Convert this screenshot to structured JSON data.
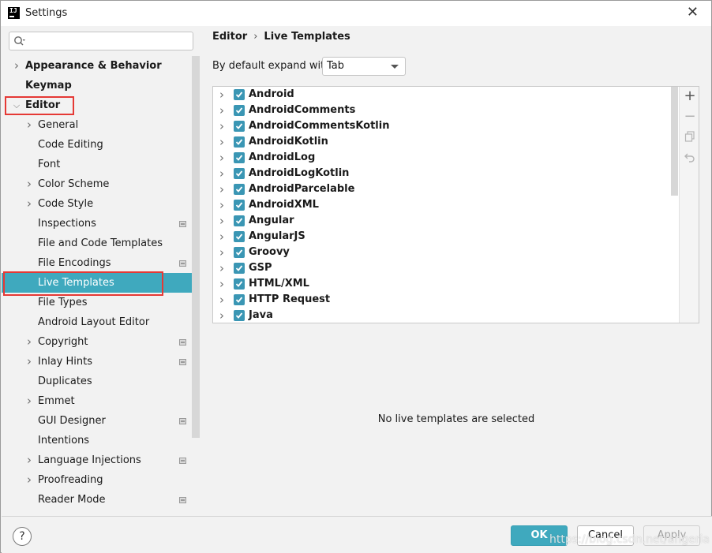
{
  "window": {
    "title": "Settings",
    "app_icon": "intellij-idea-icon",
    "close_icon": "close-icon"
  },
  "search": {
    "placeholder": "",
    "icon": "search-icon"
  },
  "tree": [
    {
      "label": "Appearance & Behavior",
      "level": 0,
      "bold": true,
      "chevron": "right",
      "project": false
    },
    {
      "label": "Keymap",
      "level": 0,
      "bold": true,
      "chevron": "none",
      "project": false
    },
    {
      "label": "Editor",
      "level": 0,
      "bold": true,
      "chevron": "down",
      "project": false,
      "highlighted": true
    },
    {
      "label": "General",
      "level": 1,
      "bold": false,
      "chevron": "right",
      "project": false
    },
    {
      "label": "Code Editing",
      "level": 1,
      "bold": false,
      "chevron": "none",
      "project": false
    },
    {
      "label": "Font",
      "level": 1,
      "bold": false,
      "chevron": "none",
      "project": false
    },
    {
      "label": "Color Scheme",
      "level": 1,
      "bold": false,
      "chevron": "right",
      "project": false
    },
    {
      "label": "Code Style",
      "level": 1,
      "bold": false,
      "chevron": "right",
      "project": false
    },
    {
      "label": "Inspections",
      "level": 1,
      "bold": false,
      "chevron": "none",
      "project": true
    },
    {
      "label": "File and Code Templates",
      "level": 1,
      "bold": false,
      "chevron": "none",
      "project": false
    },
    {
      "label": "File Encodings",
      "level": 1,
      "bold": false,
      "chevron": "none",
      "project": true
    },
    {
      "label": "Live Templates",
      "level": 1,
      "bold": false,
      "chevron": "none",
      "project": false,
      "selected": true,
      "highlighted": true
    },
    {
      "label": "File Types",
      "level": 1,
      "bold": false,
      "chevron": "none",
      "project": false
    },
    {
      "label": "Android Layout Editor",
      "level": 1,
      "bold": false,
      "chevron": "none",
      "project": false
    },
    {
      "label": "Copyright",
      "level": 1,
      "bold": false,
      "chevron": "right",
      "project": true
    },
    {
      "label": "Inlay Hints",
      "level": 1,
      "bold": false,
      "chevron": "right",
      "project": true
    },
    {
      "label": "Duplicates",
      "level": 1,
      "bold": false,
      "chevron": "none",
      "project": false
    },
    {
      "label": "Emmet",
      "level": 1,
      "bold": false,
      "chevron": "right",
      "project": false
    },
    {
      "label": "GUI Designer",
      "level": 1,
      "bold": false,
      "chevron": "none",
      "project": true
    },
    {
      "label": "Intentions",
      "level": 1,
      "bold": false,
      "chevron": "none",
      "project": false
    },
    {
      "label": "Language Injections",
      "level": 1,
      "bold": false,
      "chevron": "right",
      "project": true
    },
    {
      "label": "Proofreading",
      "level": 1,
      "bold": false,
      "chevron": "right",
      "project": false
    },
    {
      "label": "Reader Mode",
      "level": 1,
      "bold": false,
      "chevron": "none",
      "project": true
    }
  ],
  "breadcrumb": {
    "parent": "Editor",
    "current": "Live Templates",
    "separator": "›"
  },
  "expand": {
    "label": "By default expand with",
    "value": "Tab"
  },
  "template_groups": [
    {
      "label": "Android",
      "checked": true
    },
    {
      "label": "AndroidComments",
      "checked": true
    },
    {
      "label": "AndroidCommentsKotlin",
      "checked": true
    },
    {
      "label": "AndroidKotlin",
      "checked": true
    },
    {
      "label": "AndroidLog",
      "checked": true
    },
    {
      "label": "AndroidLogKotlin",
      "checked": true
    },
    {
      "label": "AndroidParcelable",
      "checked": true
    },
    {
      "label": "AndroidXML",
      "checked": true
    },
    {
      "label": "Angular",
      "checked": true
    },
    {
      "label": "AngularJS",
      "checked": true
    },
    {
      "label": "Groovy",
      "checked": true
    },
    {
      "label": "GSP",
      "checked": true
    },
    {
      "label": "HTML/XML",
      "checked": true
    },
    {
      "label": "HTTP Request",
      "checked": true
    },
    {
      "label": "Java",
      "checked": true
    }
  ],
  "toolbar": {
    "add": "+",
    "remove": "−",
    "copy_icon": "copy-icon",
    "restore_icon": "undo-icon"
  },
  "details": {
    "empty_message": "No live templates are selected"
  },
  "footer": {
    "help": "?",
    "ok": "OK",
    "cancel": "Cancel",
    "apply": "Apply",
    "watermark": "https://blog.csdn.net/angeria"
  },
  "colors": {
    "accent": "#3fa9be",
    "checkbox": "#3a96b4",
    "highlight_box": "#e53935"
  }
}
